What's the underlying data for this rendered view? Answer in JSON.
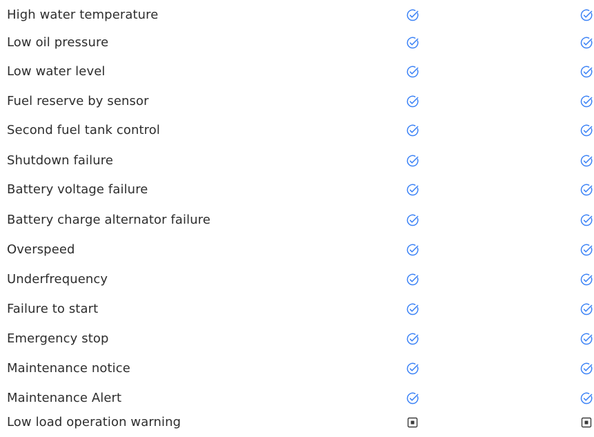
{
  "colors": {
    "check": "#3b82f6",
    "text": "#2d2d2d",
    "square": "#3a3a3a"
  },
  "icons": {
    "check": "check-circle-icon",
    "square": "dot-square-icon"
  },
  "rows": [
    {
      "label": "High water temperature",
      "col1": "check",
      "col2": "check"
    },
    {
      "label": "Low oil pressure",
      "col1": "check",
      "col2": "check"
    },
    {
      "label": "Low water level",
      "col1": "check",
      "col2": "check"
    },
    {
      "label": "Fuel reserve by sensor",
      "col1": "check",
      "col2": "check"
    },
    {
      "label": "Second fuel tank control",
      "col1": "check",
      "col2": "check"
    },
    {
      "label": "Shutdown failure",
      "col1": "check",
      "col2": "check"
    },
    {
      "label": "Battery voltage failure",
      "col1": "check",
      "col2": "check"
    },
    {
      "label": "Battery charge alternator failure",
      "col1": "check",
      "col2": "check"
    },
    {
      "label": "Overspeed",
      "col1": "check",
      "col2": "check"
    },
    {
      "label": "Underfrequency",
      "col1": "check",
      "col2": "check"
    },
    {
      "label": "Failure to start",
      "col1": "check",
      "col2": "check"
    },
    {
      "label": "Emergency stop",
      "col1": "check",
      "col2": "check"
    },
    {
      "label": "Maintenance notice",
      "col1": "check",
      "col2": "check"
    },
    {
      "label": "Maintenance Alert",
      "col1": "check",
      "col2": "check"
    },
    {
      "label": "Low load operation warning",
      "col1": "square",
      "col2": "square"
    }
  ]
}
